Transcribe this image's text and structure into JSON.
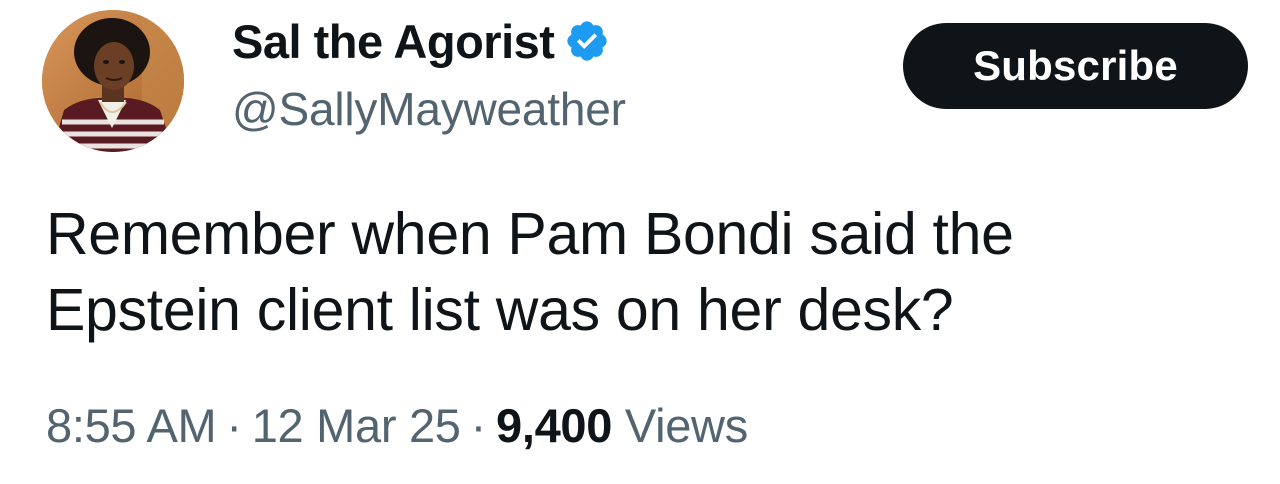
{
  "author": {
    "display_name": "Sal the Agorist",
    "handle": "@SallyMayweather",
    "verified": true,
    "verified_color": "#1d9bf0",
    "avatar_icon": "profile-photo"
  },
  "actions": {
    "subscribe_label": "Subscribe"
  },
  "tweet": {
    "text_line_1": "Remember when Pam Bondi said the",
    "text_line_2": "Epstein client list was on her desk?"
  },
  "meta": {
    "time": "8:55 AM",
    "separator": "·",
    "date": "12 Mar 25",
    "views_count": "9,400",
    "views_label": "Views"
  },
  "colors": {
    "text_primary": "#0f1419",
    "text_secondary": "#536471",
    "button_bg": "#0f1419",
    "button_text": "#ffffff"
  }
}
